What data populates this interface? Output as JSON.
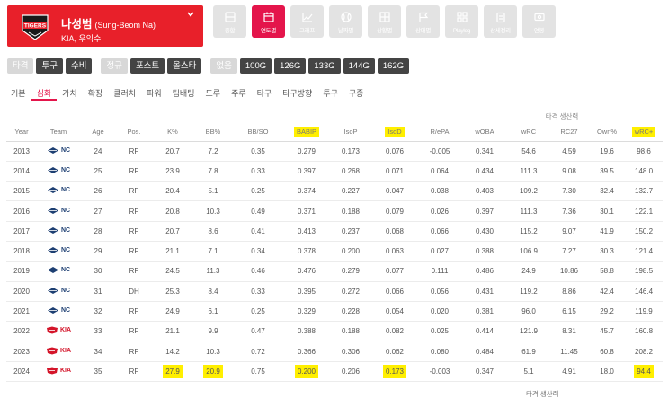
{
  "player": {
    "name": "나성범",
    "name_en": "(Sung-Beom Na)",
    "meta": "KIA, 우익수",
    "team_logo": "TIGERS",
    "dropdown_icon": "chevron-down-icon"
  },
  "view_tabs": [
    {
      "label": "종합",
      "icon": "summary-icon",
      "active": false
    },
    {
      "label": "연도별",
      "icon": "calendar-icon",
      "active": true
    },
    {
      "label": "그래프",
      "icon": "chart-icon",
      "active": false
    },
    {
      "label": "날짜별",
      "icon": "baseball-icon",
      "active": false
    },
    {
      "label": "상황별",
      "icon": "grid-icon",
      "active": false
    },
    {
      "label": "상대별",
      "icon": "flag-icon",
      "active": false
    },
    {
      "label": "Playlog",
      "icon": "play-icon",
      "active": false
    },
    {
      "label": "상세정리",
      "icon": "clipboard-icon",
      "active": false
    },
    {
      "label": "연봉",
      "icon": "money-icon",
      "active": false
    }
  ],
  "filters": {
    "role": [
      {
        "label": "타격",
        "active": false
      },
      {
        "label": "투구",
        "active": true
      },
      {
        "label": "수비",
        "active": true
      }
    ],
    "season": [
      {
        "label": "정규",
        "active": false
      },
      {
        "label": "포스트",
        "active": true
      },
      {
        "label": "올스타",
        "active": true
      }
    ],
    "games": [
      {
        "label": "없음",
        "active": false
      },
      {
        "label": "100G",
        "active": true
      },
      {
        "label": "126G",
        "active": true
      },
      {
        "label": "133G",
        "active": true
      },
      {
        "label": "144G",
        "active": true
      },
      {
        "label": "162G",
        "active": true
      }
    ]
  },
  "subtabs": [
    {
      "label": "기본",
      "active": false
    },
    {
      "label": "심화",
      "active": true
    },
    {
      "label": "가치",
      "active": false
    },
    {
      "label": "확장",
      "active": false
    },
    {
      "label": "클러치",
      "active": false
    },
    {
      "label": "파워",
      "active": false
    },
    {
      "label": "팀배팅",
      "active": false
    },
    {
      "label": "도루",
      "active": false
    },
    {
      "label": "주루",
      "active": false
    },
    {
      "label": "타구",
      "active": false
    },
    {
      "label": "타구방향",
      "active": false
    },
    {
      "label": "투구",
      "active": false
    },
    {
      "label": "구종",
      "active": false
    }
  ],
  "table": {
    "group_label": "타격 생산력",
    "columns": [
      "Year",
      "Team",
      "Age",
      "Pos.",
      "K%",
      "BB%",
      "BB/SO",
      "BABIP",
      "IsoP",
      "IsoD",
      "R/ePA",
      "wOBA",
      "wRC",
      "RC27",
      "Own%",
      "wRC+"
    ],
    "highlight_columns": [
      "BABIP",
      "IsoD",
      "wRC+"
    ],
    "rows": [
      {
        "year": "2013",
        "team": "NC",
        "age": "24",
        "pos": "RF",
        "k": "20.7",
        "bb": "7.2",
        "bbso": "0.35",
        "babip": "0.279",
        "isop": "0.173",
        "isod": "0.076",
        "repa": "-0.005",
        "woba": "0.341",
        "wrc": "54.6",
        "rc27": "4.59",
        "own": "19.6",
        "wrcp": "98.6"
      },
      {
        "year": "2014",
        "team": "NC",
        "age": "25",
        "pos": "RF",
        "k": "23.9",
        "bb": "7.8",
        "bbso": "0.33",
        "babip": "0.397",
        "isop": "0.268",
        "isod": "0.071",
        "repa": "0.064",
        "woba": "0.434",
        "wrc": "111.3",
        "rc27": "9.08",
        "own": "39.5",
        "wrcp": "148.0"
      },
      {
        "year": "2015",
        "team": "NC",
        "age": "26",
        "pos": "RF",
        "k": "20.4",
        "bb": "5.1",
        "bbso": "0.25",
        "babip": "0.374",
        "isop": "0.227",
        "isod": "0.047",
        "repa": "0.038",
        "woba": "0.403",
        "wrc": "109.2",
        "rc27": "7.30",
        "own": "32.4",
        "wrcp": "132.7"
      },
      {
        "year": "2016",
        "team": "NC",
        "age": "27",
        "pos": "RF",
        "k": "20.8",
        "bb": "10.3",
        "bbso": "0.49",
        "babip": "0.371",
        "isop": "0.188",
        "isod": "0.079",
        "repa": "0.026",
        "woba": "0.397",
        "wrc": "111.3",
        "rc27": "7.36",
        "own": "30.1",
        "wrcp": "122.1"
      },
      {
        "year": "2017",
        "team": "NC",
        "age": "28",
        "pos": "RF",
        "k": "20.7",
        "bb": "8.6",
        "bbso": "0.41",
        "babip": "0.413",
        "isop": "0.237",
        "isod": "0.068",
        "repa": "0.066",
        "woba": "0.430",
        "wrc": "115.2",
        "rc27": "9.07",
        "own": "41.9",
        "wrcp": "150.2"
      },
      {
        "year": "2018",
        "team": "NC",
        "age": "29",
        "pos": "RF",
        "k": "21.1",
        "bb": "7.1",
        "bbso": "0.34",
        "babip": "0.378",
        "isop": "0.200",
        "isod": "0.063",
        "repa": "0.027",
        "woba": "0.388",
        "wrc": "106.9",
        "rc27": "7.27",
        "own": "30.3",
        "wrcp": "121.4"
      },
      {
        "year": "2019",
        "team": "NC",
        "age": "30",
        "pos": "RF",
        "k": "24.5",
        "bb": "11.3",
        "bbso": "0.46",
        "babip": "0.476",
        "isop": "0.279",
        "isod": "0.077",
        "repa": "0.111",
        "woba": "0.486",
        "wrc": "24.9",
        "rc27": "10.86",
        "own": "58.8",
        "wrcp": "198.5"
      },
      {
        "year": "2020",
        "team": "NC",
        "age": "31",
        "pos": "DH",
        "k": "25.3",
        "bb": "8.4",
        "bbso": "0.33",
        "babip": "0.395",
        "isop": "0.272",
        "isod": "0.066",
        "repa": "0.056",
        "woba": "0.431",
        "wrc": "119.2",
        "rc27": "8.86",
        "own": "42.4",
        "wrcp": "146.4"
      },
      {
        "year": "2021",
        "team": "NC",
        "age": "32",
        "pos": "RF",
        "k": "24.9",
        "bb": "6.1",
        "bbso": "0.25",
        "babip": "0.329",
        "isop": "0.228",
        "isod": "0.054",
        "repa": "0.020",
        "woba": "0.381",
        "wrc": "96.0",
        "rc27": "6.15",
        "own": "29.2",
        "wrcp": "119.9"
      },
      {
        "year": "2022",
        "team": "KIA",
        "age": "33",
        "pos": "RF",
        "k": "21.1",
        "bb": "9.9",
        "bbso": "0.47",
        "babip": "0.388",
        "isop": "0.188",
        "isod": "0.082",
        "repa": "0.025",
        "woba": "0.414",
        "wrc": "121.9",
        "rc27": "8.31",
        "own": "45.7",
        "wrcp": "160.8"
      },
      {
        "year": "2023",
        "team": "KIA",
        "age": "34",
        "pos": "RF",
        "k": "14.2",
        "bb": "10.3",
        "bbso": "0.72",
        "babip": "0.366",
        "isop": "0.306",
        "isod": "0.062",
        "repa": "0.080",
        "woba": "0.484",
        "wrc": "61.9",
        "rc27": "11.45",
        "own": "60.8",
        "wrcp": "208.2"
      },
      {
        "year": "2024",
        "team": "KIA",
        "age": "35",
        "pos": "RF",
        "k": "27.9",
        "bb": "20.9",
        "bbso": "0.75",
        "babip": "0.200",
        "isop": "0.206",
        "isod": "0.173",
        "repa": "-0.003",
        "woba": "0.347",
        "wrc": "5.1",
        "rc27": "4.91",
        "own": "18.0",
        "wrcp": "94.4",
        "highlight": [
          "k",
          "bb",
          "babip",
          "isod",
          "wrcp"
        ]
      }
    ],
    "footer_group_label": "타격 생산력"
  },
  "colors": {
    "brand_red": "#e8202a",
    "active_tab": "#e4154b",
    "highlight": "#ffef00",
    "pill_dark": "#444444",
    "pill_muted": "#d8d8d8",
    "nc_navy": "#1d3f72",
    "kia_red": "#d4152a"
  }
}
